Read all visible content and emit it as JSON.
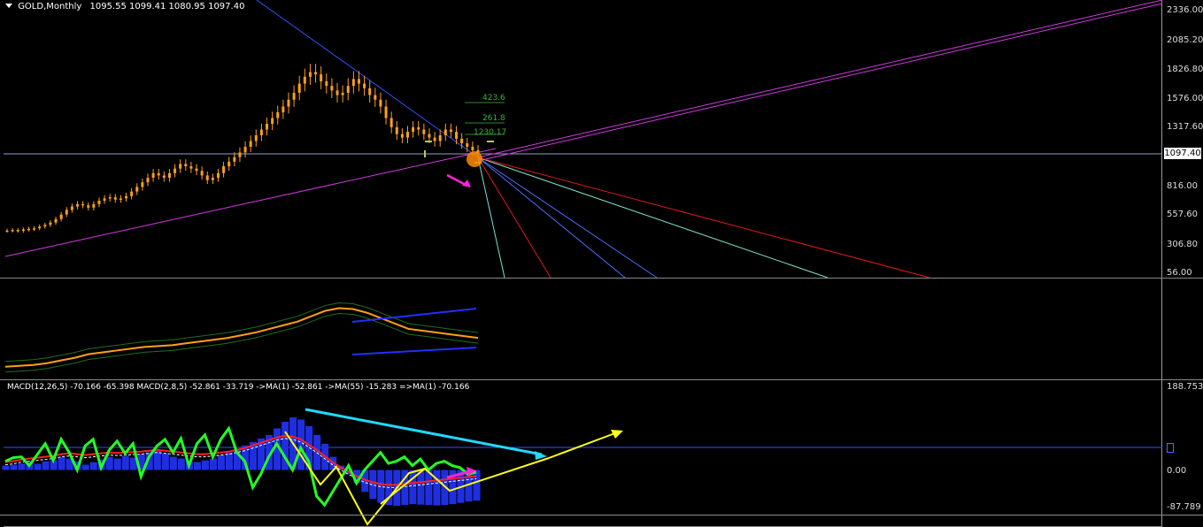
{
  "header": {
    "symbol_label": "GOLD,Monthly",
    "ohlc": "1095.55 1099.41 1080.95 1097.40"
  },
  "price_axis": {
    "ticks": [
      "2336.00",
      "2085.20",
      "1826.80",
      "1576.00",
      "1317.60",
      "1097.40",
      "816.00",
      "557.60",
      "306.80",
      "56.00"
    ],
    "current_price": "1097.40"
  },
  "fib_labels": {
    "f1": "423.6",
    "f2": "261.8",
    "f3": "1230.17"
  },
  "macd": {
    "legend": "MACD(12,26,5) -70.166 -65.398  MACD(2,8,5) -52.861 -33.719  ->MA(1) -52.861  ->MA(55) -15.283  =>MA(1) -70.166",
    "axis_ticks": [
      "188.753",
      "0.00",
      "-87.789"
    ]
  },
  "colors": {
    "candle": "#ff9f1a",
    "fan_magenta": "#d23ae0",
    "fan_red": "#e01818",
    "fan_cyan": "#7fe0d0",
    "fan_blue": "#4a6cff",
    "macd_hist": "#1f2fe0",
    "macd_line": "#22ff22",
    "signal": "#ff2020",
    "arrow_yellow": "#ffff10",
    "arrow_cyan": "#22d8ff",
    "arrow_magenta": "#ff22d8"
  },
  "chart_data": [
    {
      "type": "candlestick",
      "title": "GOLD,Monthly",
      "ylim": [
        56.0,
        2336.0
      ],
      "series": [
        {
          "values": [
            420,
            425,
            418,
            430,
            435,
            440,
            455,
            470,
            490,
            520,
            560,
            600,
            630,
            650,
            640,
            620,
            650,
            680,
            700,
            710,
            690,
            700,
            720,
            760,
            800,
            840,
            880,
            920,
            900,
            880,
            920,
            960,
            1000,
            980,
            960,
            940,
            900,
            860,
            880,
            920,
            980,
            1020,
            1060,
            1100,
            1150,
            1200,
            1250,
            1300,
            1350,
            1400,
            1450,
            1500,
            1560,
            1620,
            1700,
            1760,
            1800,
            1780,
            1720,
            1680,
            1640,
            1600,
            1620,
            1680,
            1740,
            1700,
            1660,
            1600,
            1560,
            1500,
            1400,
            1320,
            1260,
            1230,
            1280,
            1320,
            1300,
            1260,
            1230,
            1200,
            1250,
            1300,
            1280,
            1220,
            1180,
            1150,
            1120,
            1097
          ]
        }
      ]
    },
    {
      "type": "line",
      "series": [
        {
          "values": [
            0.1,
            0.11,
            0.12,
            0.14,
            0.17,
            0.2,
            0.24,
            0.26,
            0.28,
            0.3,
            0.32,
            0.33,
            0.34,
            0.36,
            0.38,
            0.4,
            0.42,
            0.45,
            0.48,
            0.52,
            0.56,
            0.6,
            0.66,
            0.72,
            0.75,
            0.74,
            0.7,
            0.64,
            0.58,
            0.52,
            0.5,
            0.48,
            0.46,
            0.44,
            0.42
          ]
        }
      ]
    },
    {
      "type": "bar+line",
      "ylim": [
        -87.789,
        188.753
      ],
      "series": [
        {
          "values": [
            10,
            12,
            15,
            18,
            14,
            20,
            22,
            30,
            26,
            20,
            12,
            18,
            24,
            30,
            26,
            32,
            28,
            36,
            40,
            44,
            38,
            30,
            26,
            20,
            18,
            22,
            26,
            34,
            40,
            48,
            56,
            64,
            72,
            80,
            95,
            110,
            120,
            115,
            100,
            80,
            60,
            30,
            10,
            -10,
            -30,
            -50,
            -66,
            -75,
            -80,
            -82,
            -80,
            -78,
            -79,
            -80,
            -81,
            -80,
            -78,
            -75,
            -72,
            -70
          ]
        },
        {
          "values": [
            20,
            28,
            30,
            10,
            35,
            60,
            22,
            70,
            40,
            0,
            55,
            70,
            5,
            45,
            66,
            38,
            60,
            -15,
            30,
            55,
            70,
            40,
            72,
            10,
            60,
            80,
            30,
            70,
            95,
            40,
            20,
            -40,
            -10,
            30,
            60,
            30,
            0,
            50,
            20,
            -60,
            -80,
            -50,
            -20,
            10,
            -30,
            0,
            20,
            40,
            15,
            20,
            30,
            10,
            25,
            0,
            15,
            20,
            10,
            5,
            -10,
            -5
          ]
        },
        {
          "values": [
            12,
            14,
            18,
            20,
            22,
            24,
            26,
            30,
            32,
            30,
            28,
            30,
            32,
            34,
            33,
            34,
            35,
            36,
            38,
            40,
            38,
            36,
            34,
            32,
            30,
            30,
            32,
            34,
            36,
            40,
            44,
            50,
            56,
            62,
            68,
            72,
            70,
            64,
            52,
            40,
            26,
            12,
            0,
            -10,
            -20,
            -28,
            -34,
            -38,
            -40,
            -40,
            -38,
            -36,
            -34,
            -32,
            -30,
            -28,
            -26,
            -24,
            -22,
            -20
          ]
        }
      ]
    }
  ]
}
